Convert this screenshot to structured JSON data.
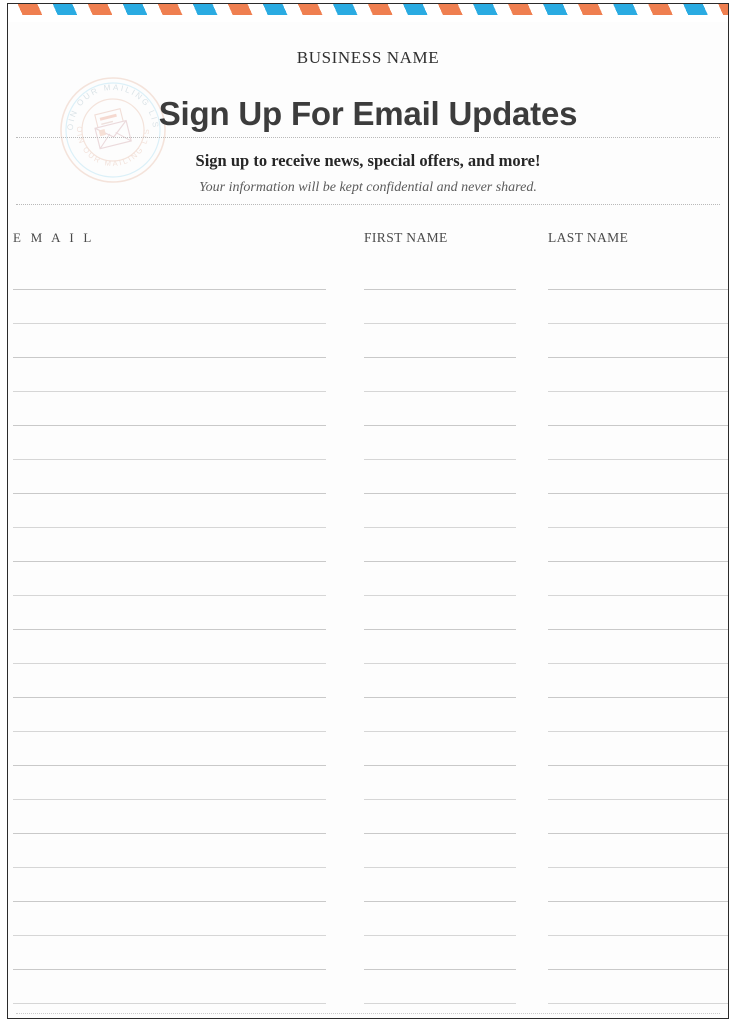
{
  "page": {
    "business_name": "BUSINESS NAME",
    "title": "Sign Up For Email Updates",
    "subtitle": "Sign up to receive news, special offers, and more!",
    "disclaimer": "Your information will be kept confidential and never shared."
  },
  "stamp": {
    "icon": "postal-stamp-envelope-icon",
    "text_top": "JOIN OUR MAILING LIST",
    "text_bottom": "JOIN OUR MAILING LIST"
  },
  "border": {
    "style": "airmail-diagonal-stripes",
    "color_blue": "#2AABE2",
    "color_orange": "#EF7F50"
  },
  "form": {
    "columns": [
      {
        "key": "email",
        "header": "E M A I L",
        "rows": 22
      },
      {
        "key": "firstname",
        "header": "FIRST NAME",
        "rows": 22
      },
      {
        "key": "lastname",
        "header": "LAST NAME",
        "rows": 22
      }
    ],
    "row_count": 22
  },
  "colors": {
    "title_text": "#3C3C3C",
    "body_text": "#2F2F2F",
    "muted_text": "#5B5B5B",
    "rule_line": "#CFCFCF",
    "frame": "#2B2B2B"
  }
}
